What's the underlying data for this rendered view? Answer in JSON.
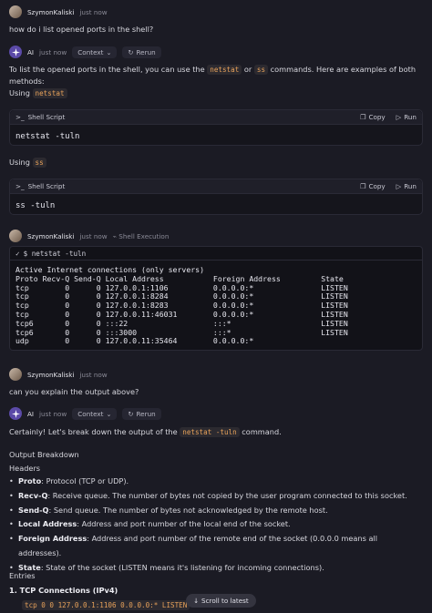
{
  "messages": {
    "user1": {
      "name": "SzymonKaliski",
      "time": "just now",
      "text": "how do i list opened ports in the shell?"
    },
    "ai1": {
      "name": "AI",
      "time": "just now",
      "context_label": "Context",
      "rerun_label": "Rerun",
      "intro_pre": "To list the opened ports in the shell, you can use the ",
      "cmd_a": "netstat",
      "or": " or ",
      "cmd_b": "ss",
      "intro_post": " commands. Here are examples of both methods:",
      "using_label": "Using ",
      "blocks": [
        {
          "lang": "Shell Script",
          "copy": "Copy",
          "run": "Run",
          "code": "netstat -tuln"
        },
        {
          "lang": "Shell Script",
          "copy": "Copy",
          "run": "Run",
          "code": "ss -tuln"
        }
      ]
    },
    "user2": {
      "name": "SzymonKaliski",
      "time": "just now",
      "tag": "Shell Execution",
      "command": "$ netstat -tuln",
      "output": "Active Internet connections (only servers)\nProto Recv-Q Send-Q Local Address           Foreign Address         State\ntcp        0      0 127.0.0.1:1106          0.0.0.0:*               LISTEN\ntcp        0      0 127.0.0.1:8284          0.0.0.0:*               LISTEN\ntcp        0      0 127.0.0.1:8283          0.0.0.0:*               LISTEN\ntcp        0      0 127.0.0.11:46031        0.0.0.0:*               LISTEN\ntcp6       0      0 :::22                   :::*                    LISTEN\ntcp6       0      0 :::3000                 :::*                    LISTEN\nudp        0      0 127.0.0.11:35464        0.0.0.0:*"
    },
    "user3": {
      "name": "SzymonKaliski",
      "time": "just now",
      "text": "can you explain the output above?"
    },
    "ai2": {
      "name": "AI",
      "time": "just now",
      "context_label": "Context",
      "rerun_label": "Rerun",
      "intro_pre": "Certainly! Let's break down the output of the ",
      "cmd": "netstat -tuln",
      "intro_post": " command.",
      "breakdown": "Output Breakdown",
      "headers": "Headers",
      "items": [
        {
          "term": "Proto",
          "desc": ": Protocol (TCP or UDP)."
        },
        {
          "term": "Recv-Q",
          "desc": ": Receive queue. The number of bytes not copied by the user program connected to this socket."
        },
        {
          "term": "Send-Q",
          "desc": ": Send queue. The number of bytes not acknowledged by the remote host."
        },
        {
          "term": "Local Address",
          "desc": ": Address and port number of the local end of the socket."
        },
        {
          "term": "Foreign Address",
          "desc": ": Address and port number of the remote end of the socket (0.0.0.0 means all addresses)."
        },
        {
          "term": "State",
          "desc": ": State of the socket (LISTEN means it's listening for incoming connections)."
        }
      ],
      "entries": "Entries",
      "entry1_title": "1. TCP Connections (IPv4)",
      "entry1_code": "tcp 0 0 127.0.0.1:1106 0.0.0.0:* LISTEN"
    }
  },
  "scroll_label": "Scroll to latest"
}
